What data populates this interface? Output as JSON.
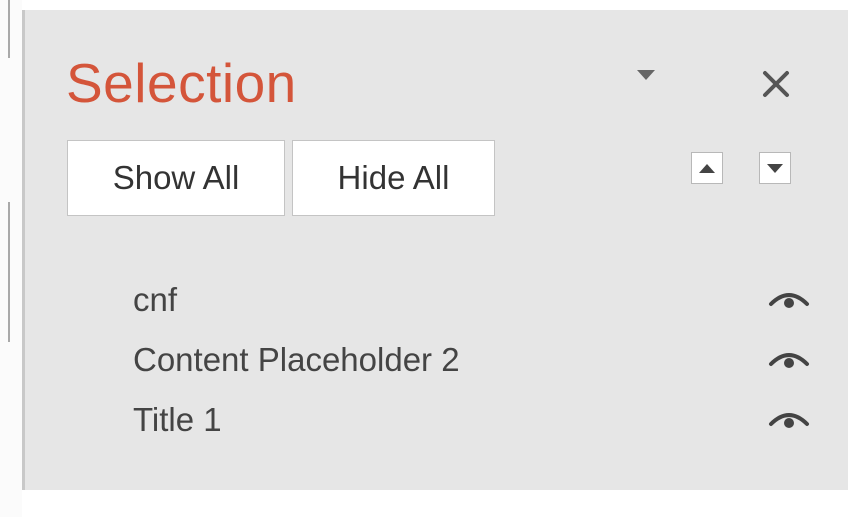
{
  "pane": {
    "title": "Selection",
    "options_icon": "chevron-down-icon",
    "close_icon": "close-icon"
  },
  "toolbar": {
    "show_all_label": "Show All",
    "hide_all_label": "Hide All",
    "bring_forward_icon": "triangle-up-icon",
    "send_backward_icon": "triangle-down-icon"
  },
  "items": [
    {
      "label": "cnf",
      "icon": "eye-icon",
      "visible": true
    },
    {
      "label": "Content Placeholder 2",
      "icon": "eye-icon",
      "visible": true
    },
    {
      "label": "Title 1",
      "icon": "eye-icon",
      "visible": true
    }
  ],
  "colors": {
    "title": "#d4553a",
    "pane_background": "#e6e6e6",
    "button_background": "#ffffff",
    "text": "#444444"
  }
}
